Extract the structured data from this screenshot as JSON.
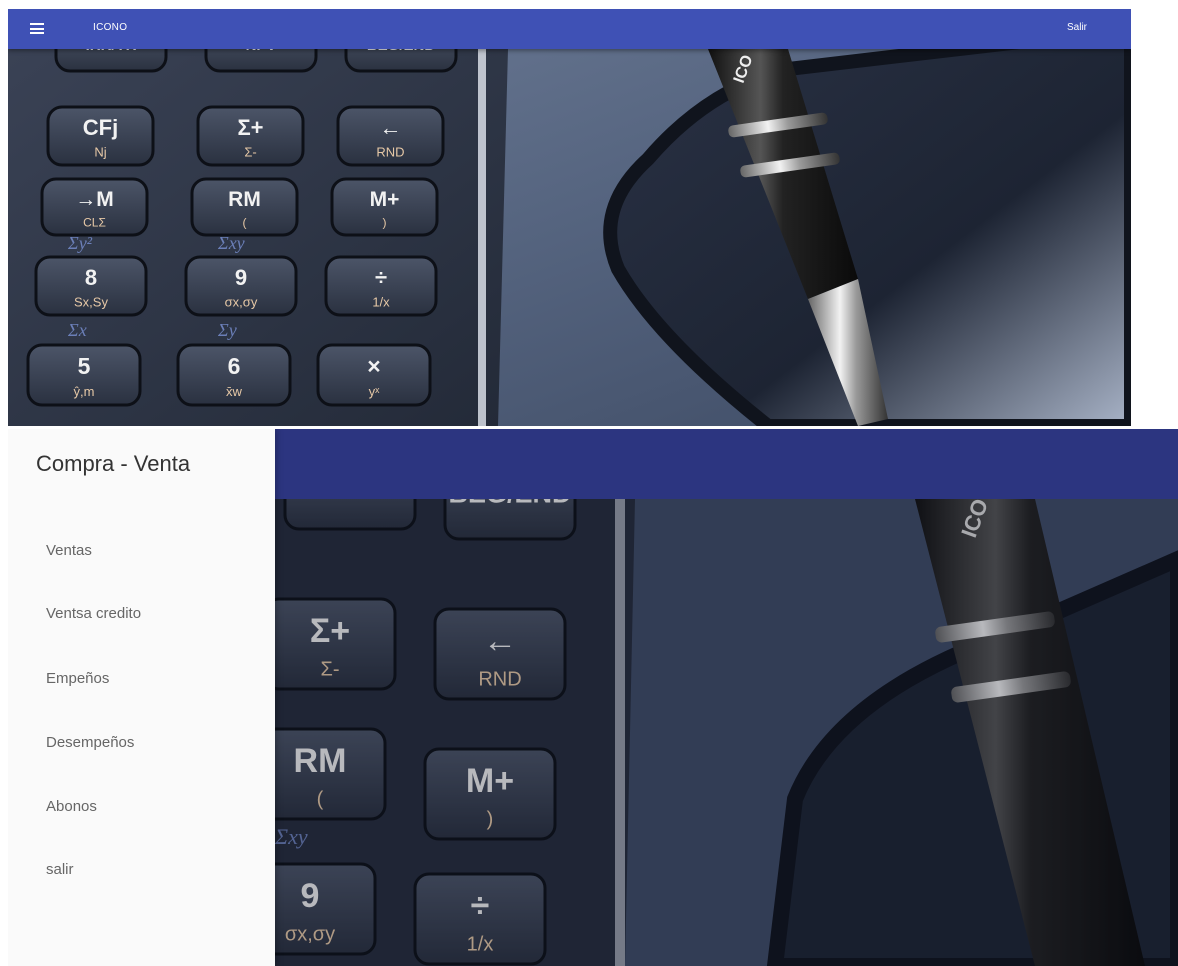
{
  "appbar": {
    "brand": "ICONO",
    "logout_label": "Salir",
    "menu_icon": "hamburger-menu-icon",
    "color": "#3f51b5"
  },
  "hero": {
    "description_icon": "calculator-pen-background-image"
  },
  "drawer": {
    "title": "Compra - Venta",
    "items": [
      {
        "label": "Ventas"
      },
      {
        "label": "Ventsa credito"
      },
      {
        "label": "Empeños"
      },
      {
        "label": "Desempeños"
      },
      {
        "label": "Abonos"
      },
      {
        "label": "salir"
      }
    ]
  },
  "calculator_keys": {
    "row0": [
      "IRR/YR",
      "NPV",
      "BEG/END"
    ],
    "row1": [
      [
        "CFj",
        "Nj"
      ],
      [
        "Σ+",
        "Σ-"
      ],
      [
        "←",
        "RND"
      ]
    ],
    "row2": [
      [
        "→M",
        "CLΣ"
      ],
      [
        "RM",
        "("
      ],
      [
        "M+",
        ")"
      ]
    ],
    "row2_blue": [
      "Σy²",
      "Σxy"
    ],
    "row3": [
      [
        "8",
        "Sx,Sy"
      ],
      [
        "9",
        "σx,σy"
      ],
      [
        "÷",
        "1/x"
      ]
    ],
    "row3_blue": [
      "Σx",
      "Σy"
    ],
    "row4": [
      [
        "5",
        "ŷ,m"
      ],
      [
        "6",
        "x̄w"
      ],
      [
        "×",
        "yˣ"
      ]
    ],
    "pen_text": "ICO"
  }
}
